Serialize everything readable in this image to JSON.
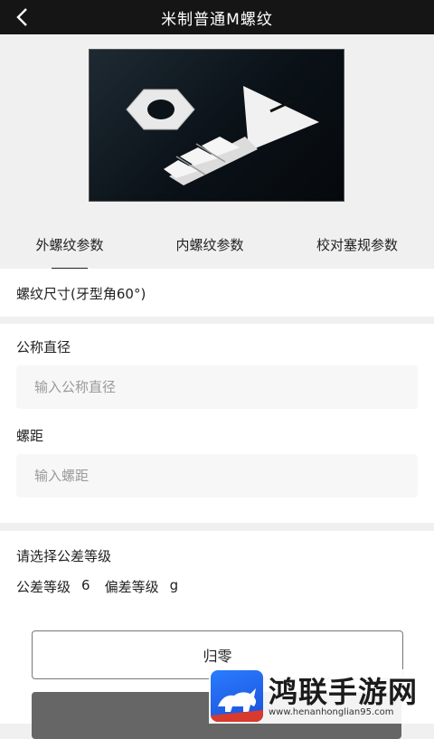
{
  "header": {
    "title": "米制普通M螺纹"
  },
  "tabs": [
    {
      "label": "外螺纹参数",
      "active": true
    },
    {
      "label": "内螺纹参数",
      "active": false
    },
    {
      "label": "校对塞规参数",
      "active": false
    }
  ],
  "size_card": {
    "text": "螺纹尺寸(牙型角60°)"
  },
  "inputs": {
    "nominal_diameter": {
      "label": "公称直径",
      "placeholder": "输入公称直径",
      "value": ""
    },
    "pitch": {
      "label": "螺距",
      "placeholder": "输入螺距",
      "value": ""
    }
  },
  "tolerance": {
    "prompt": "请选择公差等级",
    "grade_label": "公差等级",
    "grade_value": "6",
    "deviation_label": "偏差等级",
    "deviation_value": "g"
  },
  "buttons": {
    "reset": "归零",
    "calculate": "计"
  },
  "watermark": {
    "title": "鸿联手游网",
    "url": "www.henanhonglian95.com"
  },
  "colors": {
    "topbar": "#151515",
    "calc_button": "#666666",
    "badge": "#2a7cff"
  }
}
